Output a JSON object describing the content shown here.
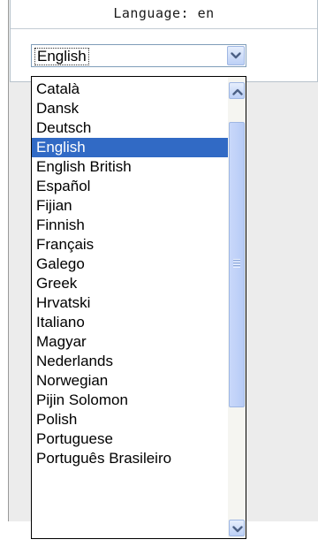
{
  "header": {
    "title": "Language: en"
  },
  "language_select": {
    "selected_value": "English",
    "options": [
      "Català",
      "Dansk",
      "Deutsch",
      "English",
      "English British",
      "Español",
      "Fijian",
      "Finnish",
      "Français",
      "Galego",
      "Greek",
      "Hrvatski",
      "Italiano",
      "Magyar",
      "Nederlands",
      "Norwegian",
      "Pijin Solomon",
      "Polish",
      "Portuguese",
      "Português Brasileiro"
    ],
    "selected_index": 3
  },
  "colors": {
    "selection": "#316ac5",
    "scroll_button": "#bcd0f6",
    "border": "#7f9db9"
  },
  "icons": {
    "dropdown_button": "chevron-down-icon",
    "scroll_up": "chevron-up-icon",
    "scroll_down": "chevron-down-icon",
    "thumb_grip": "grip-icon"
  }
}
